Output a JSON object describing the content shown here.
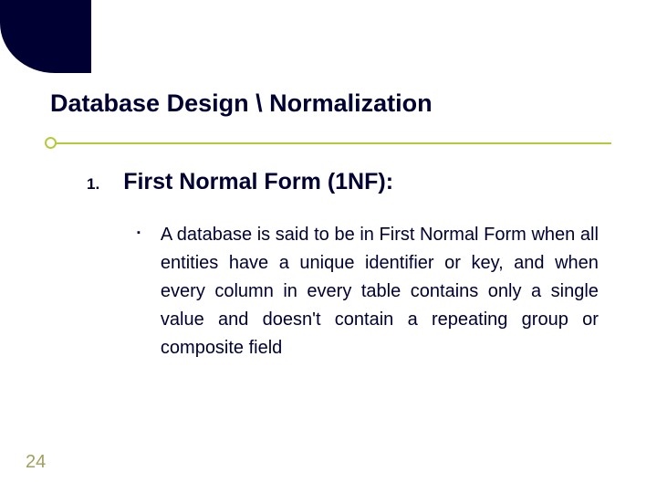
{
  "title": "Database Design \\ Normalization",
  "list": {
    "number": "1.",
    "heading": "First Normal Form (1NF):",
    "bullet": "▪",
    "body": "A database is said to be in First Normal Form when all entities have a unique identifier or key, and when every column in every table contains only a single value and doesn't contain a repeating group or composite field"
  },
  "page": "24"
}
